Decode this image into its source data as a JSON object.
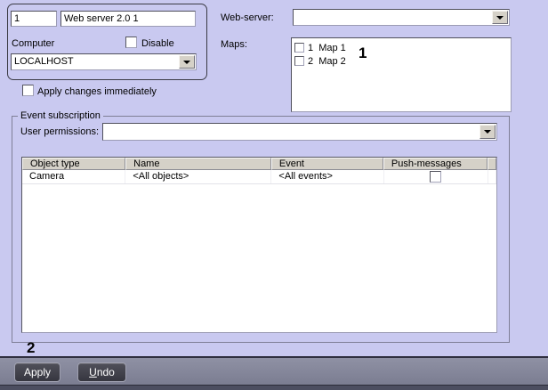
{
  "colors": {
    "background": "#c9c9f0",
    "field_background": "#ffffff",
    "table_header_background": "#d5d1c8",
    "footer_bar_top": "#8f91a4",
    "footer_bar_bottom": "#7b7d91",
    "footer_strip": "#4c4e60",
    "button_background": "#45454f",
    "button_text": "#ffffff",
    "annotation_color": "#000000"
  },
  "identity_panel": {
    "id_value": "1",
    "name_value": "Web server 2.0 1",
    "computer_label": "Computer",
    "disable_label": "Disable",
    "computer_value": "LOCALHOST"
  },
  "apply_immediately": {
    "label": "Apply changes immediately",
    "checked": false
  },
  "web_server": {
    "label": "Web-server:",
    "selected_value": ""
  },
  "maps": {
    "label": "Maps:",
    "items": [
      {
        "label": "1  Map 1",
        "checked": false
      },
      {
        "label": "2  Map 2",
        "checked": false
      }
    ],
    "annotation": "1"
  },
  "event_subscription": {
    "title": "Event subscription",
    "user_permissions_label": "User permissions:",
    "user_permissions_value": "",
    "table": {
      "columns": [
        "Object type",
        "Name",
        "Event",
        "Push-messages"
      ],
      "rows": [
        {
          "object_type": "Camera",
          "name": "<All objects>",
          "event": "<All events>",
          "push_messages_checked": false
        }
      ]
    }
  },
  "footer": {
    "apply_label": "Apply",
    "undo_underline_prefix": "U",
    "undo_rest": "ndo",
    "annotation": "2"
  }
}
